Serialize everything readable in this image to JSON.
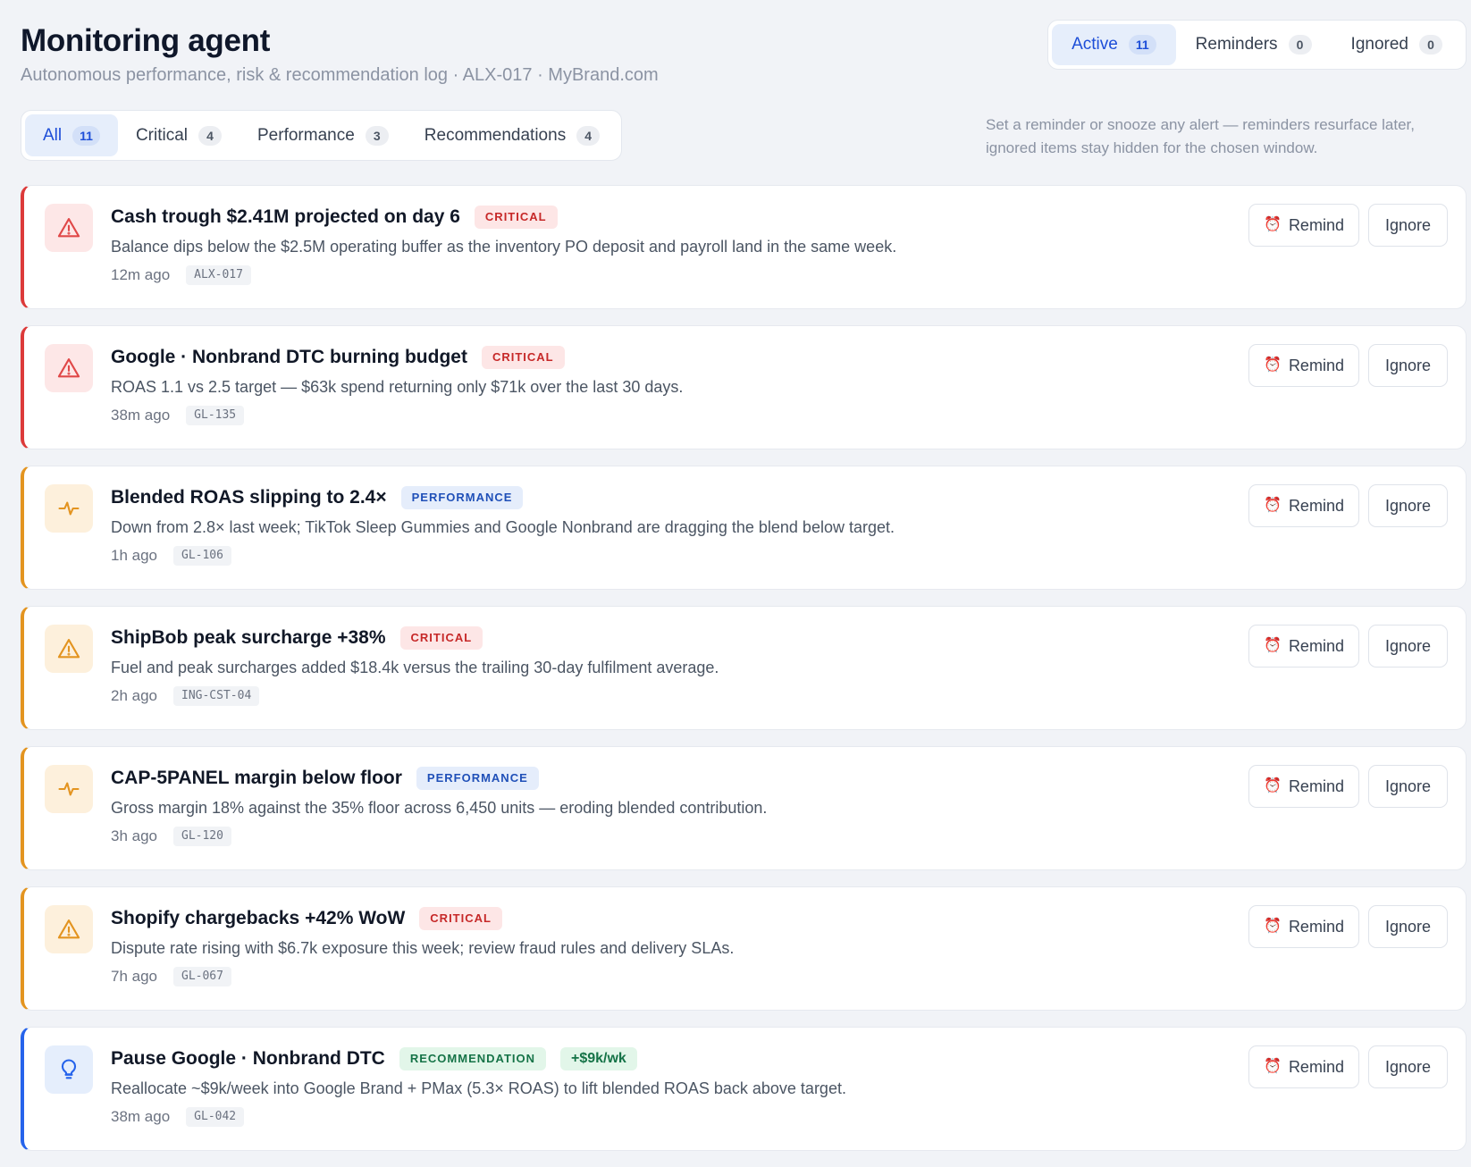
{
  "header": {
    "title": "Monitoring agent",
    "subtitle": "Autonomous performance, risk & recommendation log · ALX-017 · MyBrand.com"
  },
  "status_tabs": [
    {
      "label": "Active",
      "count": "11",
      "active": true
    },
    {
      "label": "Reminders",
      "count": "0",
      "active": false
    },
    {
      "label": "Ignored",
      "count": "0",
      "active": false
    }
  ],
  "filter_tabs": [
    {
      "label": "All",
      "count": "11",
      "active": true
    },
    {
      "label": "Critical",
      "count": "4",
      "active": false
    },
    {
      "label": "Performance",
      "count": "3",
      "active": false
    },
    {
      "label": "Recommendations",
      "count": "4",
      "active": false
    }
  ],
  "hint": "Set a reminder or snooze any alert — reminders resurface later, ignored items stay hidden for the chosen window.",
  "actions": {
    "remind_label": "Remind",
    "ignore_label": "Ignore",
    "remind_icon": "alarm-clock-icon"
  },
  "colors": {
    "critical": "#dc3a3a",
    "performance": "#e39420",
    "recommendation": "#2563eb",
    "accent": "#1d4ed8"
  },
  "alerts": [
    {
      "title": "Cash trough $2.41M projected on day 6",
      "badge": "CRITICAL",
      "badge_type": "critical",
      "description": "Balance dips below the $2.5M operating buffer as the inventory PO deposit and payroll land in the same week.",
      "time": "12m ago",
      "code": "ALX-017",
      "severity": "red",
      "icon": "warning-triangle-icon"
    },
    {
      "title": "Google · Nonbrand DTC burning budget",
      "badge": "CRITICAL",
      "badge_type": "critical",
      "description": "ROAS 1.1 vs 2.5 target — $63k spend returning only $71k over the last 30 days.",
      "time": "38m ago",
      "code": "GL-135",
      "severity": "red",
      "icon": "warning-triangle-icon"
    },
    {
      "title": "Blended ROAS slipping to 2.4×",
      "badge": "PERFORMANCE",
      "badge_type": "performance",
      "description": "Down from 2.8× last week; TikTok Sleep Gummies and Google Nonbrand are dragging the blend below target.",
      "time": "1h ago",
      "code": "GL-106",
      "severity": "amber",
      "icon": "activity-pulse-icon"
    },
    {
      "title": "ShipBob peak surcharge +38%",
      "badge": "CRITICAL",
      "badge_type": "critical",
      "description": "Fuel and peak surcharges added $18.4k versus the trailing 30-day fulfilment average.",
      "time": "2h ago",
      "code": "ING-CST-04",
      "severity": "amber",
      "icon": "warning-triangle-icon"
    },
    {
      "title": "CAP-5PANEL margin below floor",
      "badge": "PERFORMANCE",
      "badge_type": "performance",
      "description": "Gross margin 18% against the 35% floor across 6,450 units — eroding blended contribution.",
      "time": "3h ago",
      "code": "GL-120",
      "severity": "amber",
      "icon": "activity-pulse-icon"
    },
    {
      "title": "Shopify chargebacks +42% WoW",
      "badge": "CRITICAL",
      "badge_type": "critical",
      "description": "Dispute rate rising with $6.7k exposure this week; review fraud rules and delivery SLAs.",
      "time": "7h ago",
      "code": "GL-067",
      "severity": "amber",
      "icon": "warning-triangle-icon"
    },
    {
      "title": "Pause Google · Nonbrand DTC",
      "badge": "RECOMMENDATION",
      "badge_type": "recommendation",
      "impact": "+$9k/wk",
      "description": "Reallocate ~$9k/week into Google Brand + PMax (5.3× ROAS) to lift blended ROAS back above target.",
      "time": "38m ago",
      "code": "GL-042",
      "severity": "blue",
      "icon": "lightbulb-icon"
    }
  ]
}
